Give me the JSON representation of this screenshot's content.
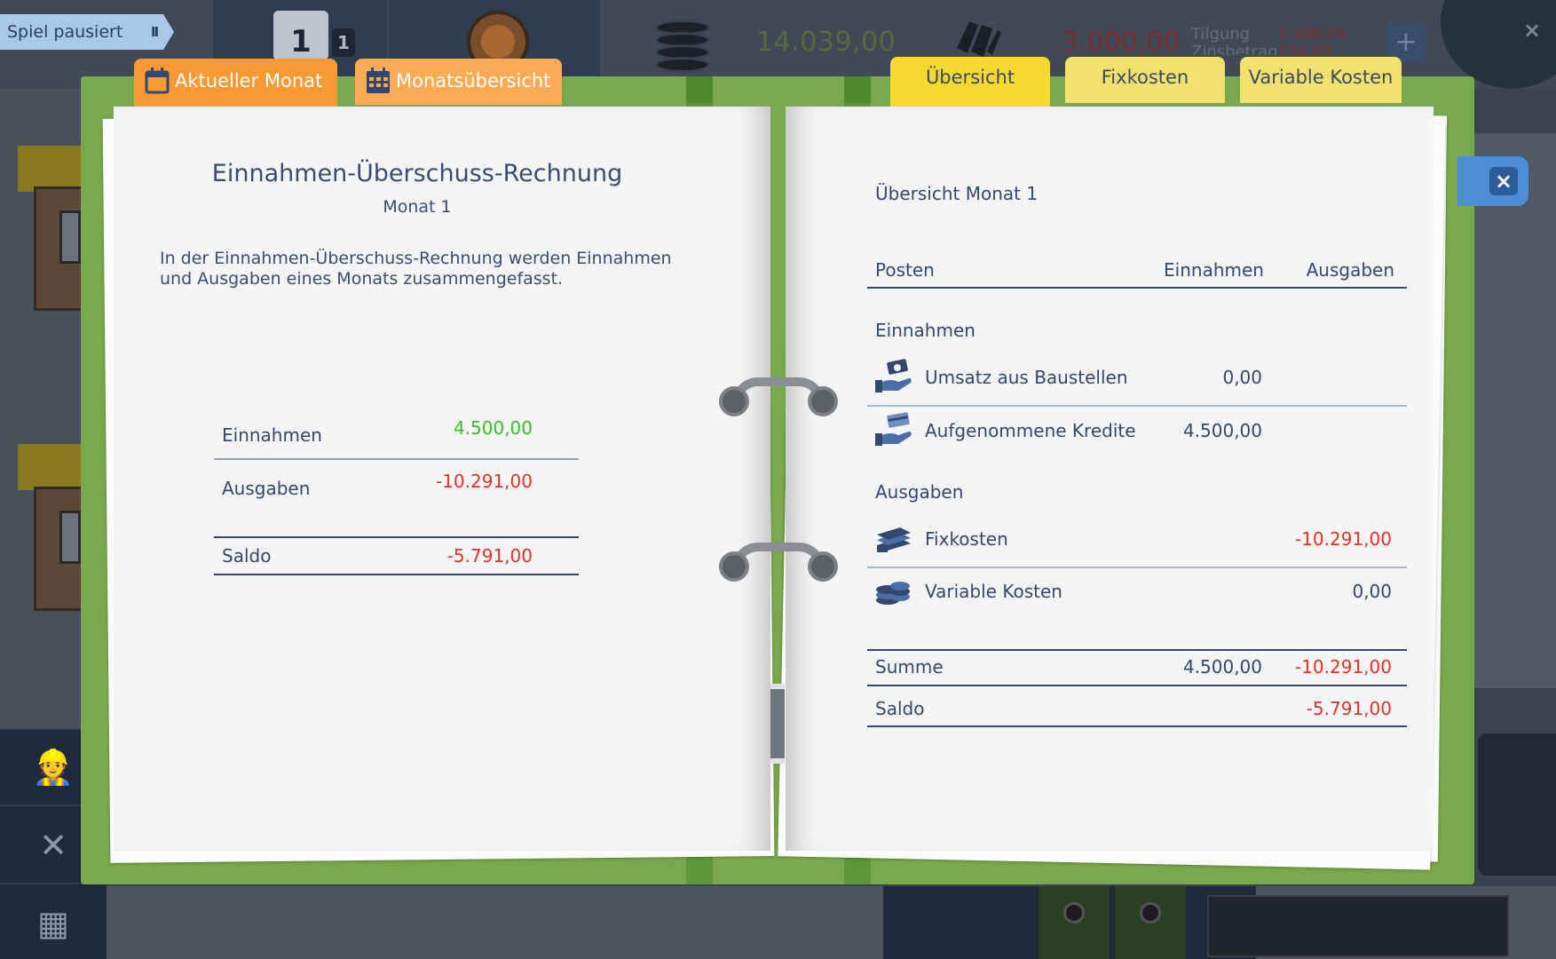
{
  "hud": {
    "pause_label": "Spiel pausiert",
    "pause_icon": "II",
    "calendar_day": "1",
    "calendar_badge": "1",
    "balance": "14.039,00",
    "loan": "3.000,00",
    "tilgung_label": "Tilgung",
    "tilgung_value": "1.500,00",
    "zins_label": "Zinsbetrag",
    "zins_value": "150,00",
    "plus": "+",
    "close": "×"
  },
  "tabs_left": {
    "current_month": "Aktueller Monat",
    "month_overview": "Monatsübersicht"
  },
  "tabs_right": {
    "overview": "Übersicht",
    "fixed_costs": "Fixkosten",
    "variable_costs": "Variable Kosten"
  },
  "eur": {
    "title": "Einnahmen-Überschuss-Rechnung",
    "subtitle": "Monat 1",
    "description": "In der Einnahmen-Überschuss-Rechnung werden Einnahmen und Ausgaben eines Monats zusammengefasst.",
    "income_label": "Einnahmen",
    "income_value": "4.500,00",
    "expenses_label": "Ausgaben",
    "expenses_value": "-10.291,00",
    "balance_label": "Saldo",
    "balance_value": "-5.791,00"
  },
  "overview": {
    "title": "Übersicht Monat 1",
    "col_item": "Posten",
    "col_income": "Einnahmen",
    "col_expenses": "Ausgaben",
    "section_income": "Einnahmen",
    "row_sales_label": "Umsatz aus Baustellen",
    "row_sales_income": "0,00",
    "row_loans_label": "Aufgenommene Kredite",
    "row_loans_income": "4.500,00",
    "section_expenses": "Ausgaben",
    "row_fixed_label": "Fixkosten",
    "row_fixed_expense": "-10.291,00",
    "row_variable_label": "Variable Kosten",
    "row_variable_expense": "0,00",
    "sum_label": "Summe",
    "sum_income": "4.500,00",
    "sum_expense": "-10.291,00",
    "balance_label": "Saldo",
    "balance_expense": "-5.791,00"
  },
  "colors": {
    "binder_green": "#7aa84d",
    "tab_orange": "#f79a35",
    "tab_yellow": "#f6d92f",
    "text_navy": "#34486e",
    "positive": "#3dbb2e",
    "negative": "#e0332b",
    "close_blue": "#4a8fd6"
  },
  "icons": {
    "calendar": "calendar-icon",
    "month_grid": "calendar-grid-icon",
    "sales": "hand-money-icon",
    "loans": "hand-card-icon",
    "fixed": "money-stack-icon",
    "variable": "coins-stack-icon"
  }
}
